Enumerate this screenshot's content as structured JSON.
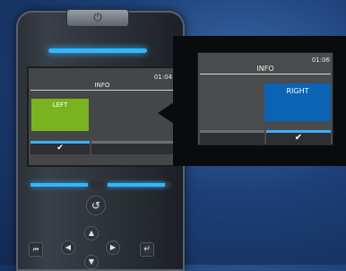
{
  "remote": {
    "screen": {
      "time": "01:04",
      "title": "INFO",
      "left_button": "LEFT",
      "confirm_icon": "✔"
    },
    "keys": {
      "power_icon": "⏻",
      "back_icon": "↺",
      "up_icon": "▲",
      "left_icon": "◀",
      "right_icon": "▶",
      "down_icon": "▼",
      "rewind_icon": "⏮",
      "enter_icon": "↵"
    }
  },
  "zoom_panel": {
    "time": "01:06",
    "title": "INFO",
    "right_button": "RIGHT",
    "confirm_icon": "✔"
  },
  "colors": {
    "accent_blue": "#31b6ff",
    "left_green": "#7ab31f",
    "right_blue": "#0a63b5"
  }
}
